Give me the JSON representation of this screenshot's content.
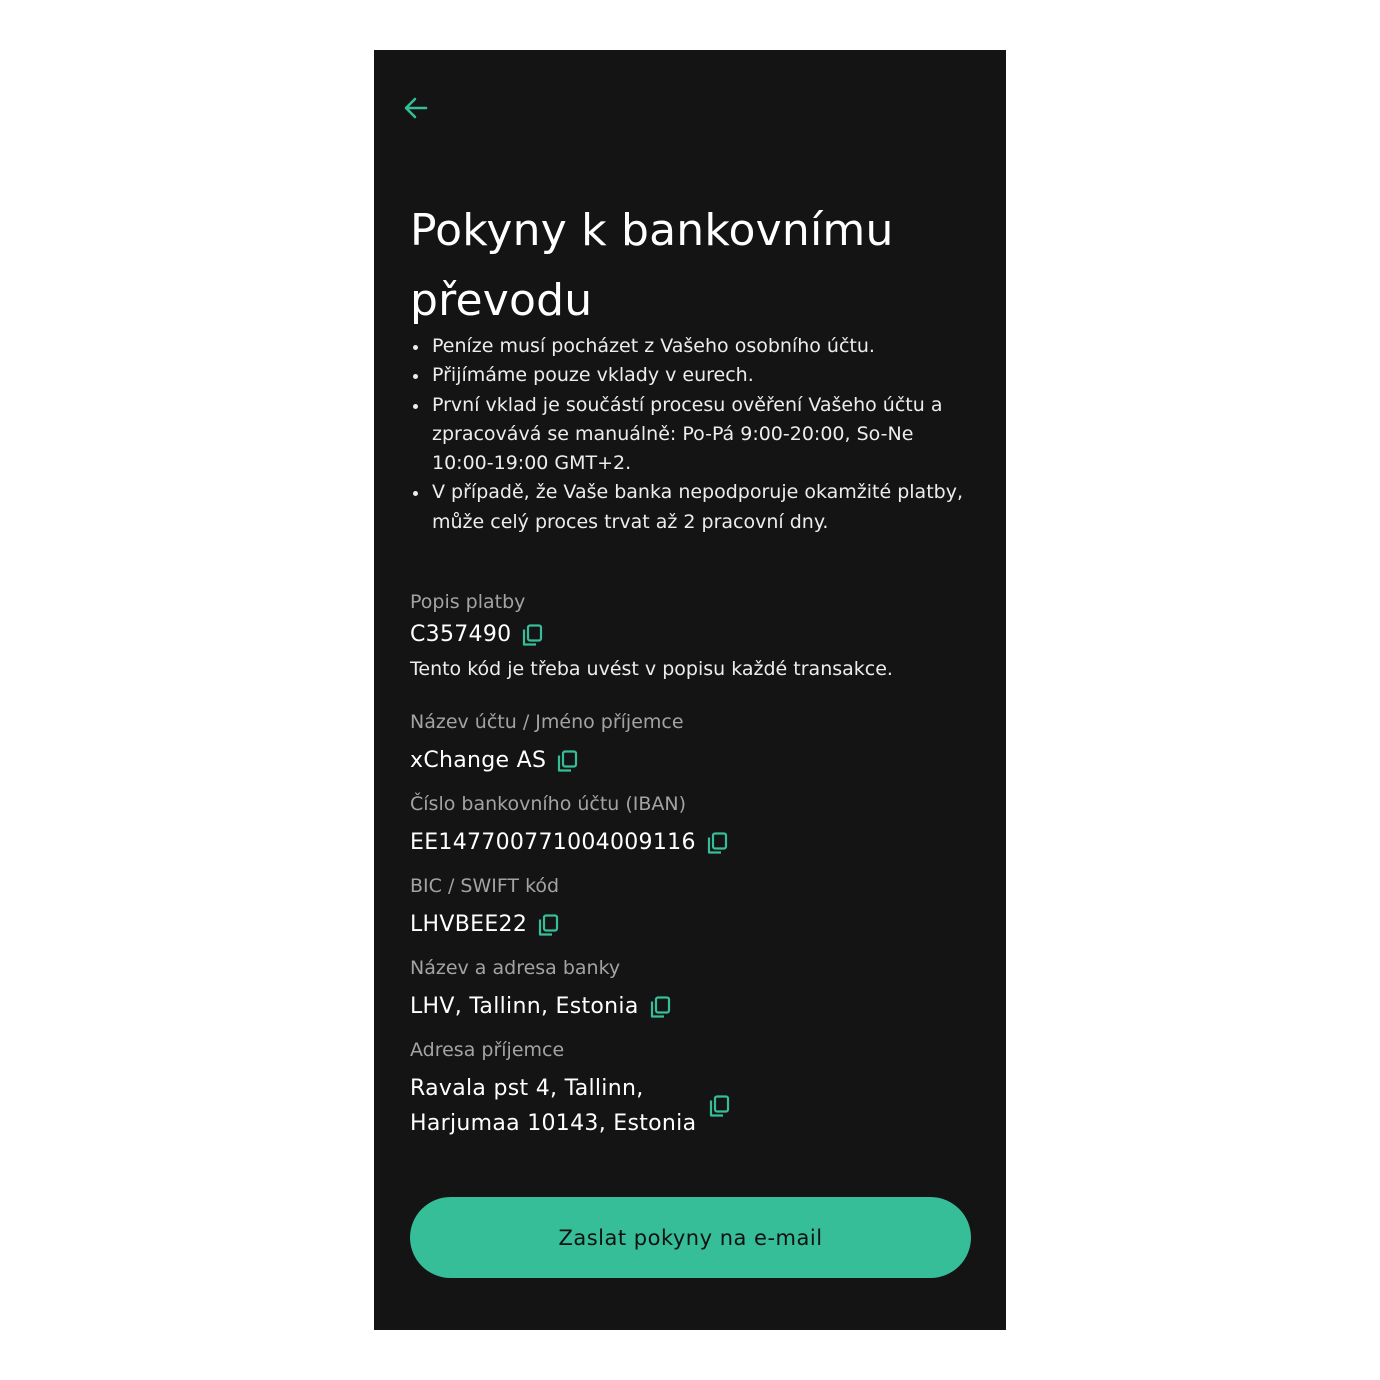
{
  "colors": {
    "background": "#141414",
    "accent": "#35be98",
    "text": "#ffffff",
    "muted": "#a3a3a3"
  },
  "header": {
    "back_icon": "arrow-left-icon",
    "title": "Pokyny k bankovnímu převodu"
  },
  "instructions": [
    "Peníze musí pocházet z Vašeho osobního účtu.",
    "Přijímáme pouze vklady v eurech.",
    "První vklad je součástí procesu ověření Vašeho účtu a zpracovává se manuálně: Po-Pá 9:00-20:00, So-Ne 10:00-19:00 GMT+2.",
    "V případě, že Vaše banka nepodporuje okamžité platby, může celý proces trvat až 2 pracovní dny."
  ],
  "fields": {
    "payment_reference": {
      "label": "Popis platby",
      "value": "C357490",
      "note": "Tento kód je třeba uvést v popisu každé transakce."
    },
    "account_name": {
      "label": "Název účtu / Jméno příjemce",
      "value": "xChange AS"
    },
    "iban": {
      "label": "Číslo bankovního účtu (IBAN)",
      "value": "EE147700771004009116"
    },
    "bic": {
      "label": "BIC / SWIFT kód",
      "value": "LHVBEE22"
    },
    "bank": {
      "label": "Název a adresa banky",
      "value": "LHV, Tallinn, Estonia"
    },
    "recipient_address": {
      "label": "Adresa příjemce",
      "line1": "Ravala pst 4, Tallinn,",
      "line2": "Harjumaa 10143, Estonia"
    }
  },
  "copy_icon": "copy-icon",
  "actions": {
    "email_button_label": "Zaslat pokyny na e-mail"
  }
}
